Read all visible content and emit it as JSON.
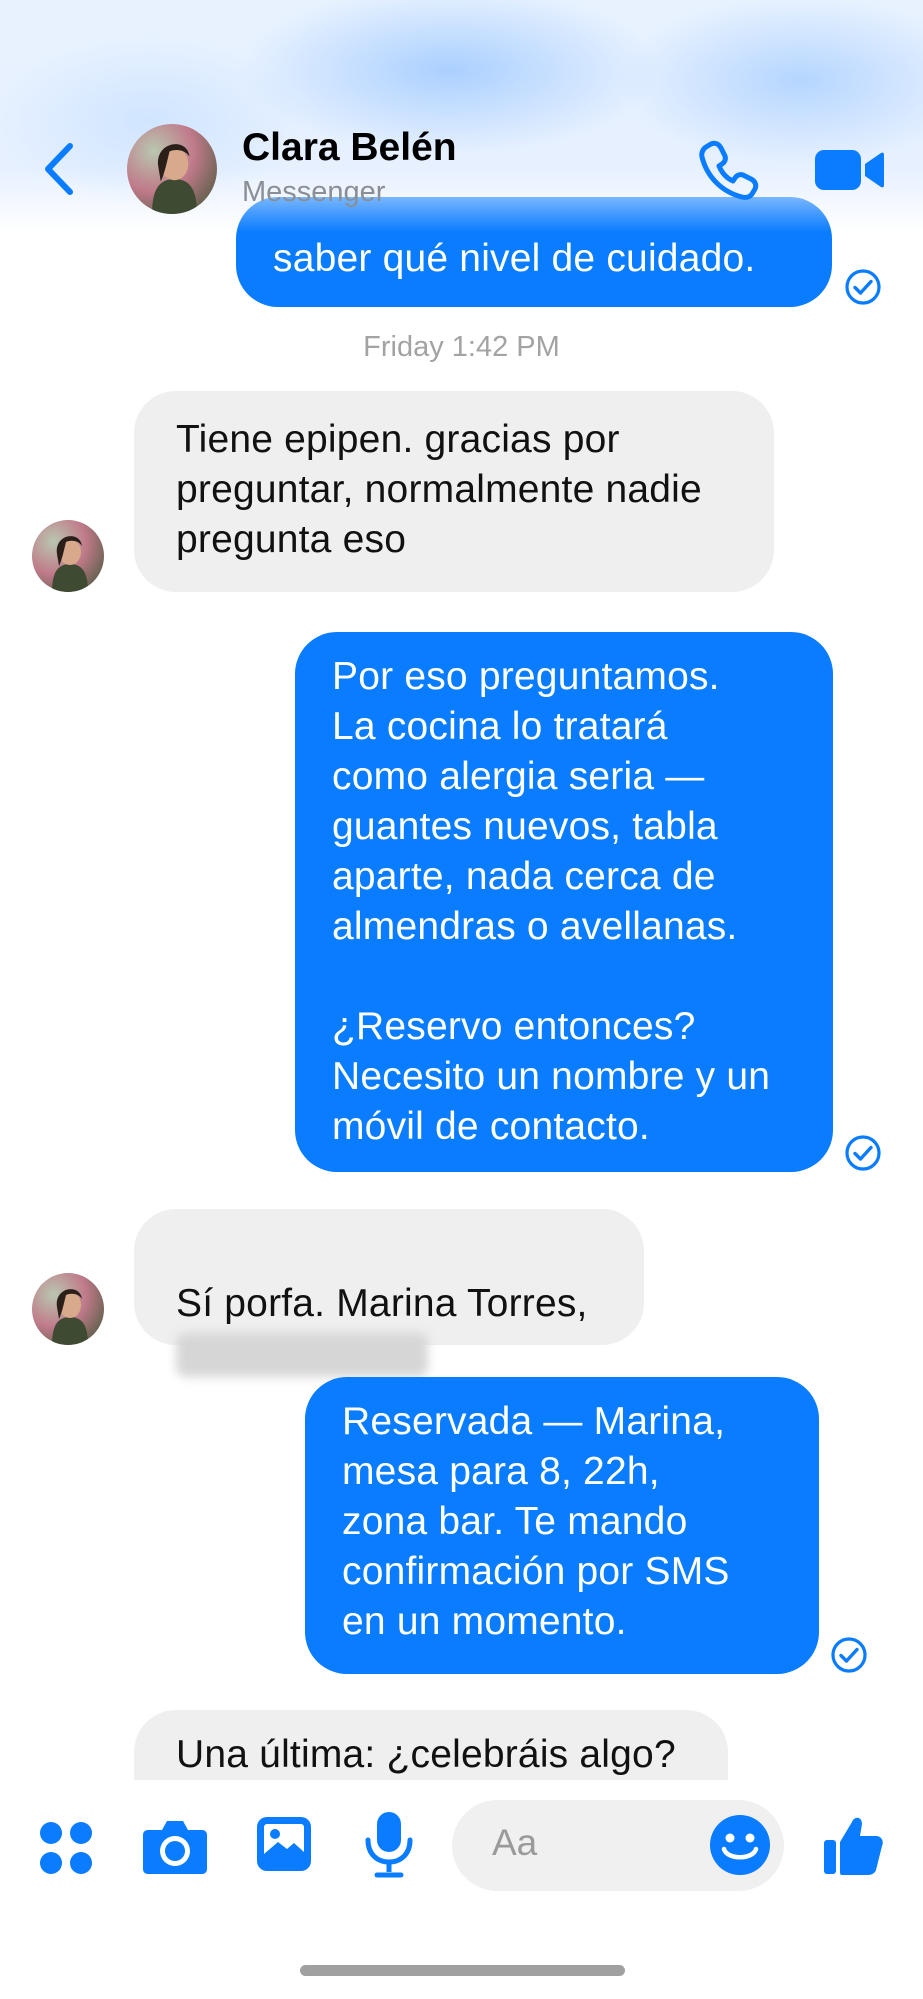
{
  "header": {
    "contact_name": "Clara Belén",
    "contact_subtitle": "Messenger"
  },
  "timestamp": "Friday 1:42 PM",
  "messages": [
    {
      "direction": "sent",
      "text": "saber qué nivel de cuidado."
    },
    {
      "direction": "received",
      "text": "Tiene epipen. gracias por\npreguntar, normalmente nadie\npregunta eso"
    },
    {
      "direction": "sent",
      "text": "Por eso preguntamos.\nLa cocina lo  tratará\ncomo alergia seria —\nguantes nuevos, tabla\naparte,  nada cerca de\nalmendras o avellanas.\n\n¿Reservo entonces?\nNecesito un nombre y un\nmóvil de contacto."
    },
    {
      "direction": "received",
      "text": "Sí porfa. Marina Torres,"
    },
    {
      "direction": "sent",
      "text": "Reservada — Marina,\nmesa para 8, 22h,\nzona bar. Te mando\nconfirmación por SMS\nen un momento."
    },
    {
      "direction": "received",
      "text": "Una última: ¿celebráis algo?"
    }
  ],
  "composer": {
    "placeholder": "Aa"
  },
  "icons": {
    "back": "chevron-left-icon",
    "call": "phone-icon",
    "video": "video-camera-icon",
    "apps": "apps-grid-icon",
    "camera": "camera-icon",
    "gallery": "photo-icon",
    "mic": "microphone-icon",
    "emoji": "smiley-icon",
    "like": "thumbs-up-icon",
    "read": "read-receipt-check-icon"
  },
  "colors": {
    "accent": "#0a7cff",
    "received_bubble": "#efefef",
    "timestamp": "#a3a3a3"
  }
}
